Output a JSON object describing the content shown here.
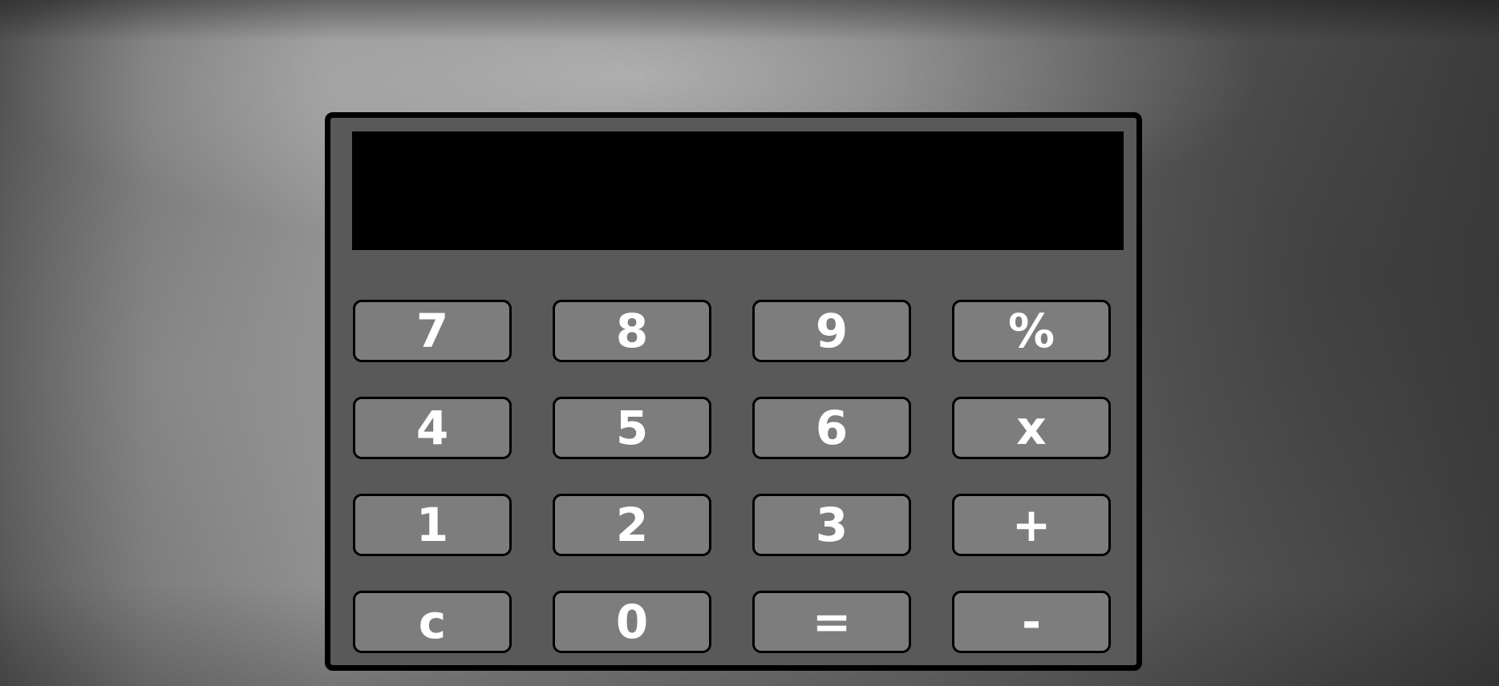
{
  "calculator": {
    "display_value": "",
    "keys": [
      {
        "label": "7",
        "name": "key-7"
      },
      {
        "label": "8",
        "name": "key-8"
      },
      {
        "label": "9",
        "name": "key-9"
      },
      {
        "label": "%",
        "name": "key-percent"
      },
      {
        "label": "4",
        "name": "key-4"
      },
      {
        "label": "5",
        "name": "key-5"
      },
      {
        "label": "6",
        "name": "key-6"
      },
      {
        "label": "x",
        "name": "key-multiply"
      },
      {
        "label": "1",
        "name": "key-1"
      },
      {
        "label": "2",
        "name": "key-2"
      },
      {
        "label": "3",
        "name": "key-3"
      },
      {
        "label": "+",
        "name": "key-plus"
      },
      {
        "label": "c",
        "name": "key-clear"
      },
      {
        "label": "0",
        "name": "key-0"
      },
      {
        "label": "=",
        "name": "key-equals"
      },
      {
        "label": "-",
        "name": "key-minus"
      }
    ]
  },
  "colors": {
    "body": "#595959",
    "key": "#7d7d7d",
    "display": "#000000",
    "key_text": "#ffffff"
  }
}
